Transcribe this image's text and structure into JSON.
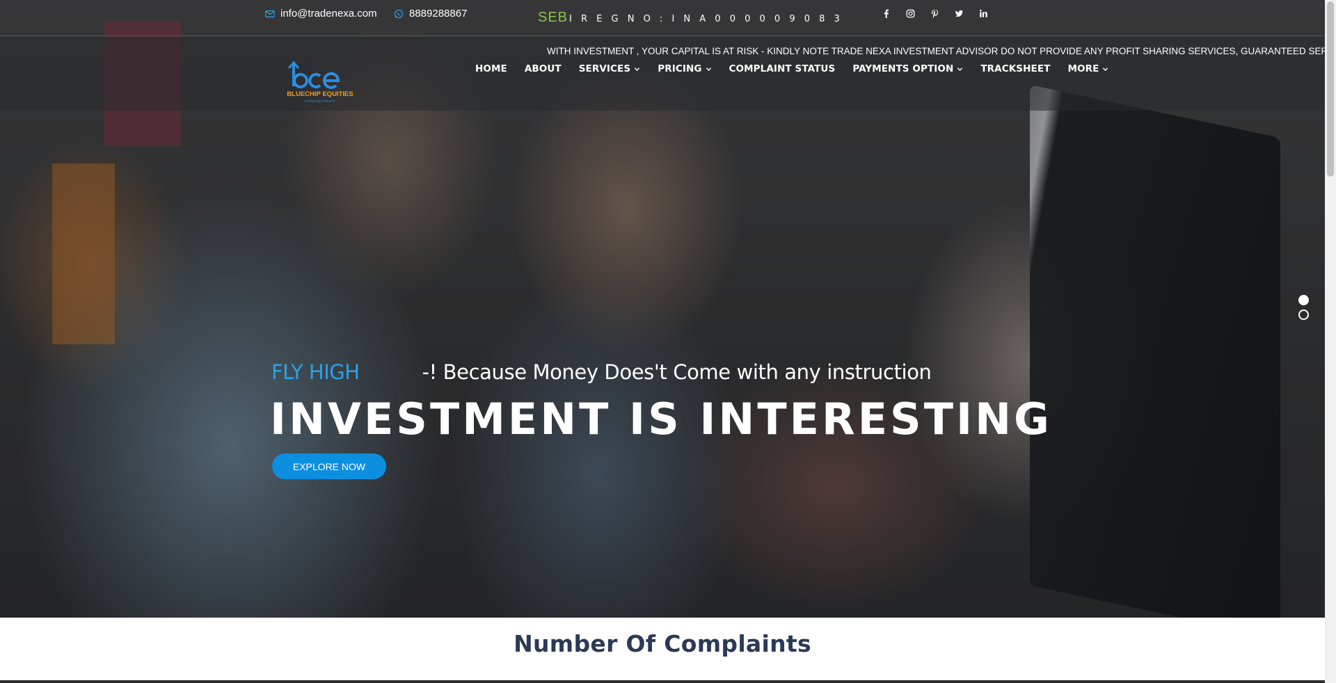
{
  "topbar": {
    "email": "info@tradenexa.com",
    "phone": "8889288867",
    "sebi_label": "SEB",
    "sebi_reg": "I R E G N O : I N A 0 0 0 0 0 9 0 8 3",
    "social": [
      "facebook-icon",
      "instagram-icon",
      "pinterest-icon",
      "twitter-icon",
      "linkedin-icon"
    ]
  },
  "disclaimer": "WITH INVESTMENT , YOUR CAPITAL IS AT RISK - KINDLY NOTE TRADE NEXA INVESTMENT ADVISOR DO NOT PROVIDE ANY PROFIT SHARING SERVICES, GUARANTEED SERVICE AND",
  "logo": {
    "mark": "bce",
    "name": "BLUECHIP EQUITIES",
    "tagline": "EARN ONLY PROFIT"
  },
  "nav": {
    "items": [
      {
        "label": "HOME",
        "dropdown": false
      },
      {
        "label": "ABOUT",
        "dropdown": false
      },
      {
        "label": "SERVICES",
        "dropdown": true
      },
      {
        "label": "PRICING",
        "dropdown": true
      },
      {
        "label": "COMPLAINT STATUS",
        "dropdown": false
      },
      {
        "label": "PAYMENTS OPTION",
        "dropdown": true
      },
      {
        "label": "TRACKSHEET",
        "dropdown": false
      },
      {
        "label": "MORE",
        "dropdown": true
      }
    ]
  },
  "hero": {
    "tag_accent": "FLY HIGH",
    "tag_rest": "-! Because Money Does't Come with any instruction",
    "headline": "INVESTMENT IS INTERESTING",
    "cta": "EXPLORE NOW",
    "slides": 2,
    "active_slide": 1
  },
  "section": {
    "title": "Number Of Complaints"
  },
  "colors": {
    "accent": "#2aa3ea",
    "button": "#0d8fe0",
    "sebi": "#8bc34a",
    "section_title": "#2b3a55"
  }
}
